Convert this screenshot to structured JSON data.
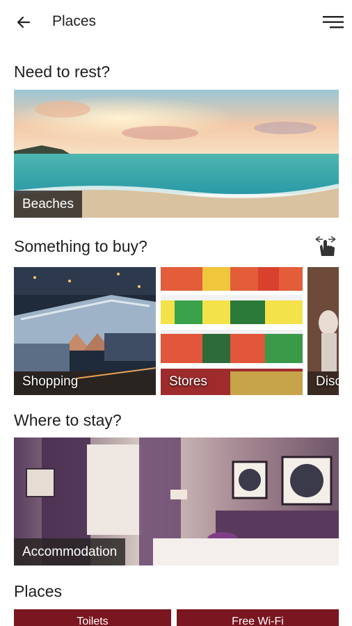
{
  "app_bar": {
    "title": "Places",
    "back_icon": "arrow-left-icon",
    "menu_icon": "hamburger-menu-icon"
  },
  "sections": {
    "rest": {
      "title": "Need to rest?",
      "card_label": "Beaches"
    },
    "buy": {
      "title": "Something to buy?",
      "swipe_icon": "swipe-hand-icon",
      "cards": [
        "Shopping",
        "Stores",
        "Discounts"
      ]
    },
    "stay": {
      "title": "Where to stay?",
      "card_label": "Accommodation"
    },
    "places": {
      "title": "Places",
      "buttons": [
        "Toilets",
        "Free Wi-Fi"
      ]
    }
  },
  "colors": {
    "accent": "#7a1620",
    "label_bg": "#2a2624"
  }
}
